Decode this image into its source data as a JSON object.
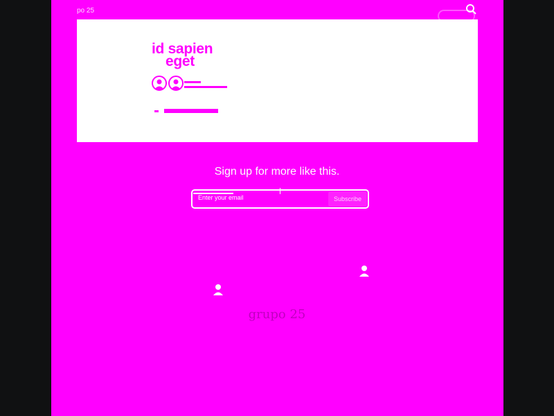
{
  "header": {
    "site_title": "po 25"
  },
  "article": {
    "title_line1": "id sapien",
    "title_line2": "eget"
  },
  "subscribe": {
    "heading": "Sign up for more like this.",
    "email_placeholder": "Enter your email",
    "button_label": "Subscribe"
  },
  "footer": {
    "logo_text": "grupo 25"
  },
  "colors": {
    "accent": "#ff00ff",
    "background": "#101112",
    "card": "#ffffff"
  }
}
